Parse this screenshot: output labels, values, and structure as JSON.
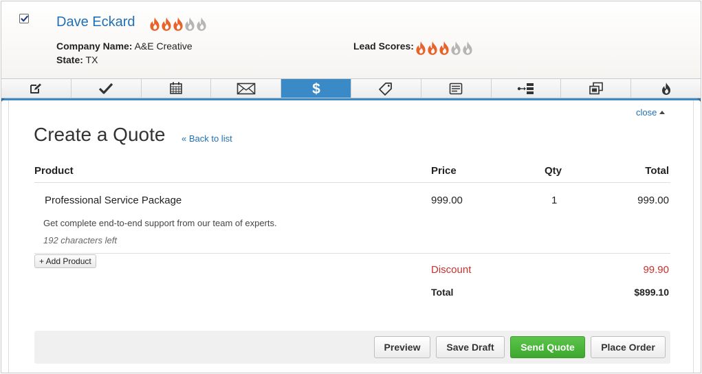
{
  "contact": {
    "name": "Dave Eckard",
    "checked": true,
    "company_label": "Company Name:",
    "company_value": "A&E Creative",
    "state_label": "State:",
    "state_value": "TX",
    "lead_scores_label": "Lead Scores:",
    "score_filled": 3,
    "score_max": 5
  },
  "tabs": [
    {
      "icon": "edit-note-icon",
      "active": false
    },
    {
      "icon": "checkmark-icon",
      "active": false
    },
    {
      "icon": "calendar-icon",
      "active": false
    },
    {
      "icon": "email-envelope-icon",
      "active": false
    },
    {
      "icon": "dollar-sign-icon",
      "active": true
    },
    {
      "icon": "tag-icon",
      "active": false
    },
    {
      "icon": "form-icon",
      "active": false
    },
    {
      "icon": "sequence-flow-icon",
      "active": false
    },
    {
      "icon": "duplicate-windows-icon",
      "active": false
    },
    {
      "icon": "flame-icon",
      "active": false
    }
  ],
  "quote": {
    "close_label": "close",
    "title": "Create a Quote",
    "back_label": "« Back to list",
    "columns": {
      "product": "Product",
      "price": "Price",
      "qty": "Qty",
      "total": "Total"
    },
    "items": [
      {
        "name": "Professional Service Package",
        "price": "999.00",
        "qty": "1",
        "total": "999.00",
        "description": "Get complete end-to-end support from our team of experts.",
        "chars_left": "192 characters left"
      }
    ],
    "add_product_label": "+ Add Product",
    "discount_label": "Discount",
    "discount_value": "99.90",
    "total_label": "Total",
    "total_value": "$899.10"
  },
  "actions": {
    "preview": "Preview",
    "save_draft": "Save Draft",
    "send_quote": "Send Quote",
    "place_order": "Place Order"
  },
  "colors": {
    "link_blue": "#1f6fb5",
    "active_tab": "#3a8ac8",
    "flame_orange": "#e8632a",
    "flame_grey": "#b5b5b5",
    "discount_red": "#c9302c",
    "send_green": "#4cb43a"
  }
}
